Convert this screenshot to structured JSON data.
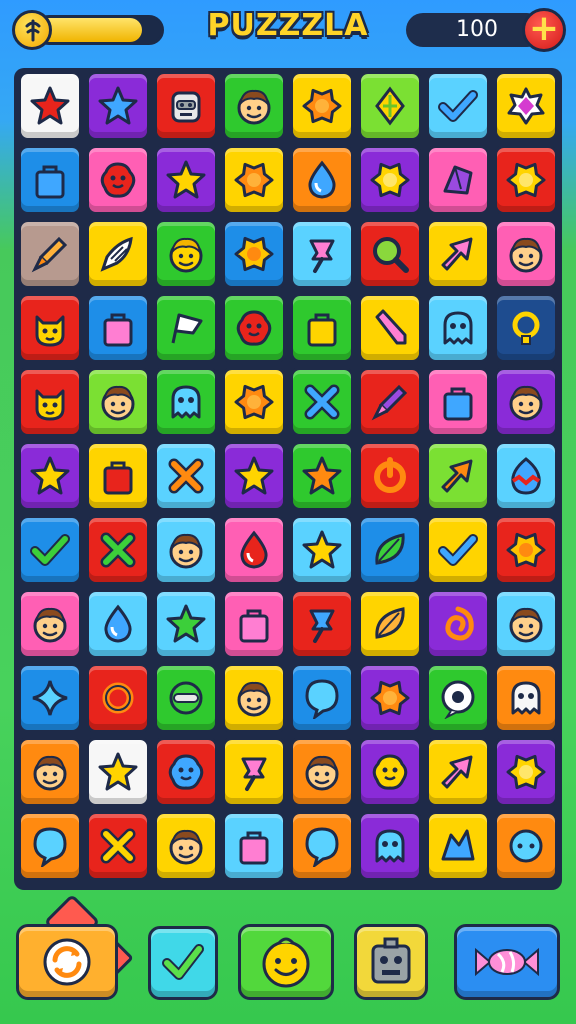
{
  "header": {
    "title": "PUZZZLA",
    "score": "100",
    "progress_fraction": 0.85,
    "coin_icon": "coin-icon",
    "plus_icon": "plus-icon"
  },
  "palette": {
    "red": "#e8241c",
    "purple": "#8a2bd8",
    "green": "#2fc92e",
    "yellow": "#ffd400",
    "lightblue": "#5ad2ff",
    "blue": "#1e8ee8",
    "pink": "#ff5fb4",
    "orange": "#ff8a10",
    "white": "#f7f7f7",
    "tan": "#b79a8f",
    "navy": "#1e4c8f",
    "lime": "#7be033"
  },
  "board": {
    "rows": [
      [
        {
          "c": "white",
          "i": "star-red"
        },
        {
          "c": "purple",
          "i": "star-blue"
        },
        {
          "c": "red",
          "i": "robot-face"
        },
        {
          "c": "green",
          "i": "boy-face"
        },
        {
          "c": "yellow",
          "i": "sun-orange"
        },
        {
          "c": "lime",
          "i": "leaf-gem"
        },
        {
          "c": "lightblue",
          "i": "check-blue"
        },
        {
          "c": "yellow",
          "i": "gem-pink"
        }
      ],
      [
        {
          "c": "blue",
          "i": "bag-blue"
        },
        {
          "c": "pink",
          "i": "blob-red"
        },
        {
          "c": "purple",
          "i": "star-yellow"
        },
        {
          "c": "yellow",
          "i": "sun-orange"
        },
        {
          "c": "orange",
          "i": "drop-blue"
        },
        {
          "c": "purple",
          "i": "sun-yellow"
        },
        {
          "c": "pink",
          "i": "crystal-purple"
        },
        {
          "c": "red",
          "i": "sun-yellow"
        }
      ],
      [
        {
          "c": "tan",
          "i": "brush"
        },
        {
          "c": "yellow",
          "i": "wing-white"
        },
        {
          "c": "green",
          "i": "alien-face"
        },
        {
          "c": "blue",
          "i": "flower-yellow"
        },
        {
          "c": "lightblue",
          "i": "pin-pink"
        },
        {
          "c": "red",
          "i": "magnifier"
        },
        {
          "c": "yellow",
          "i": "arrow-pink"
        },
        {
          "c": "pink",
          "i": "boy-face"
        }
      ],
      [
        {
          "c": "red",
          "i": "cat-face"
        },
        {
          "c": "blue",
          "i": "bag-pink"
        },
        {
          "c": "green",
          "i": "flag-white"
        },
        {
          "c": "green",
          "i": "blob-red"
        },
        {
          "c": "green",
          "i": "bag-yellow"
        },
        {
          "c": "yellow",
          "i": "pencil-pink"
        },
        {
          "c": "lightblue",
          "i": "ghost-blue"
        },
        {
          "c": "navy",
          "i": "bulb-yellow"
        }
      ],
      [
        {
          "c": "red",
          "i": "cat-face"
        },
        {
          "c": "lime",
          "i": "boy-face"
        },
        {
          "c": "green",
          "i": "ghost-blue"
        },
        {
          "c": "yellow",
          "i": "sun-orange"
        },
        {
          "c": "green",
          "i": "cross-blue"
        },
        {
          "c": "red",
          "i": "brush-purple"
        },
        {
          "c": "pink",
          "i": "bag-blue"
        },
        {
          "c": "purple",
          "i": "boy-face"
        }
      ],
      [
        {
          "c": "purple",
          "i": "star-yellow"
        },
        {
          "c": "yellow",
          "i": "bag-red"
        },
        {
          "c": "lightblue",
          "i": "cross-orange"
        },
        {
          "c": "purple",
          "i": "star-yellow"
        },
        {
          "c": "green",
          "i": "star-orange"
        },
        {
          "c": "red",
          "i": "power-orange"
        },
        {
          "c": "lime",
          "i": "arrow-orange"
        },
        {
          "c": "lightblue",
          "i": "egg-color"
        }
      ],
      [
        {
          "c": "blue",
          "i": "check-green"
        },
        {
          "c": "red",
          "i": "cross-green"
        },
        {
          "c": "lightblue",
          "i": "boy-face"
        },
        {
          "c": "pink",
          "i": "drop-red"
        },
        {
          "c": "lightblue",
          "i": "star-yellow"
        },
        {
          "c": "blue",
          "i": "leaf-green"
        },
        {
          "c": "yellow",
          "i": "check-blue"
        },
        {
          "c": "red",
          "i": "flower-yellow"
        }
      ],
      [
        {
          "c": "pink",
          "i": "boy-face"
        },
        {
          "c": "lightblue",
          "i": "drop-blue"
        },
        {
          "c": "lightblue",
          "i": "star-green"
        },
        {
          "c": "pink",
          "i": "bag-pink"
        },
        {
          "c": "red",
          "i": "pin-blue"
        },
        {
          "c": "yellow",
          "i": "leaf-orange"
        },
        {
          "c": "purple",
          "i": "spiral-orange"
        },
        {
          "c": "lightblue",
          "i": "boy-face"
        }
      ],
      [
        {
          "c": "blue",
          "i": "spark-blue"
        },
        {
          "c": "red",
          "i": "ring-orange"
        },
        {
          "c": "green",
          "i": "capsule"
        },
        {
          "c": "yellow",
          "i": "boy-face"
        },
        {
          "c": "blue",
          "i": "balloon-blue"
        },
        {
          "c": "purple",
          "i": "sun-orange"
        },
        {
          "c": "green",
          "i": "eye-white"
        },
        {
          "c": "orange",
          "i": "ghost-white"
        }
      ],
      [
        {
          "c": "orange",
          "i": "boy-face"
        },
        {
          "c": "white",
          "i": "star-yellow"
        },
        {
          "c": "red",
          "i": "blob-blue"
        },
        {
          "c": "yellow",
          "i": "pin-pink"
        },
        {
          "c": "orange",
          "i": "boy-face"
        },
        {
          "c": "purple",
          "i": "smile-yellow"
        },
        {
          "c": "yellow",
          "i": "arrow-pink"
        },
        {
          "c": "purple",
          "i": "sun-yellow"
        }
      ],
      [
        {
          "c": "orange",
          "i": "balloon-blue"
        },
        {
          "c": "red",
          "i": "cross-yellow"
        },
        {
          "c": "yellow",
          "i": "boy-face"
        },
        {
          "c": "lightblue",
          "i": "bag-pink"
        },
        {
          "c": "orange",
          "i": "balloon-blue"
        },
        {
          "c": "purple",
          "i": "ghost-blue"
        },
        {
          "c": "yellow",
          "i": "crystal-blue"
        },
        {
          "c": "orange",
          "i": "chat-blue"
        }
      ]
    ]
  },
  "bottom": {
    "buttons": [
      {
        "name": "shuffle-button",
        "icon": "refresh-icon",
        "color": "#ffb02e"
      },
      {
        "name": "check-button",
        "icon": "check-icon",
        "color": "#40d8e8"
      },
      {
        "name": "hint-button",
        "icon": "smiley-icon",
        "color": "#52d83c"
      },
      {
        "name": "robot-button",
        "icon": "robot-icon",
        "color": "#f2d83a"
      },
      {
        "name": "candy-button",
        "icon": "candy-icon",
        "color": "#2b8ef2"
      }
    ]
  }
}
